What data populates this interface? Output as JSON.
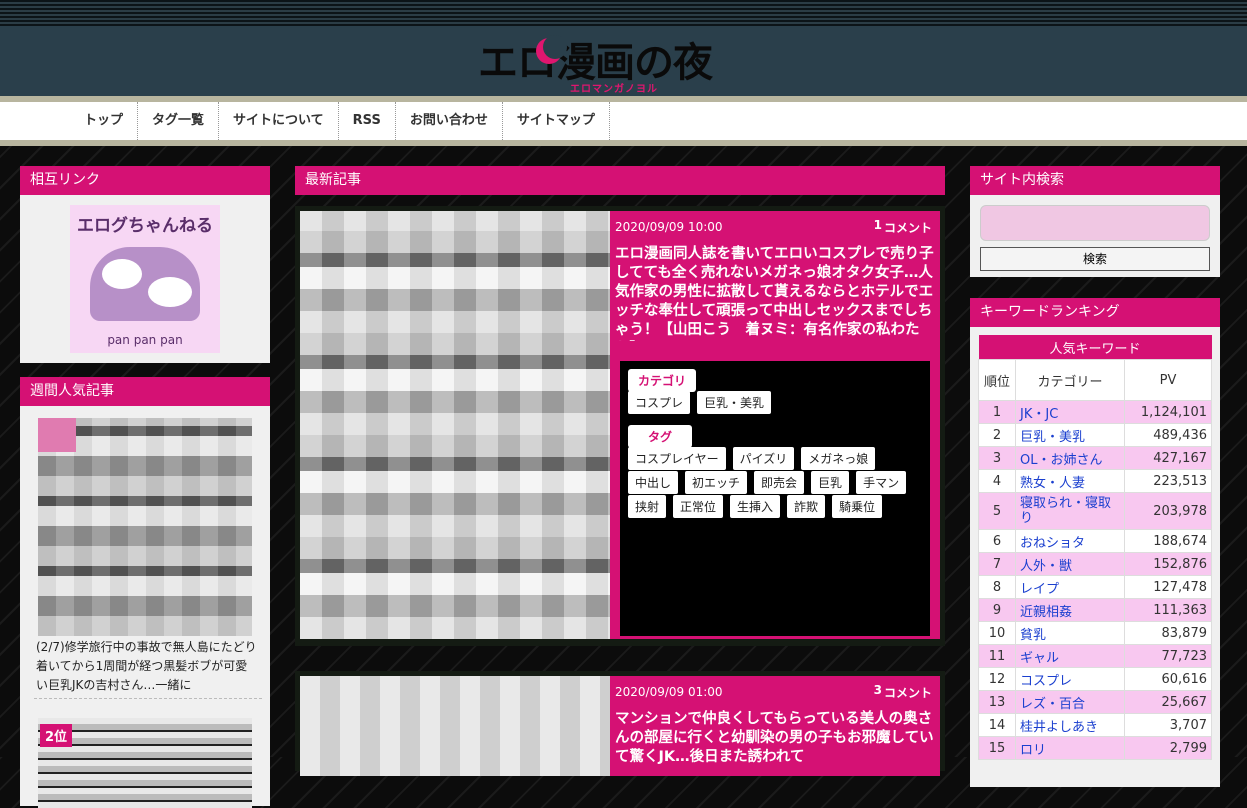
{
  "colors": {
    "accent": "#d51174",
    "header": "#2a3f4b",
    "panel": "#f0f0f0"
  },
  "logo": {
    "title": "エロ漫画の夜",
    "subtitle": "エロマンガノヨル"
  },
  "nav": {
    "items": [
      "トップ",
      "タグ一覧",
      "サイトについて",
      "RSS",
      "お問い合わせ",
      "サイトマップ"
    ]
  },
  "left": {
    "mutual": {
      "title": "相互リンク",
      "banner_title": "エログちゃんねる",
      "banner_sub": "pan pan pan"
    },
    "weekly": {
      "title": "週間人気記事",
      "item1_text": "(2/7)修学旅行中の事故で無人島にたどり着いてから1周間が経つ黒髪ボブが可愛い巨乳JKの吉村さん…一緒に",
      "rank2_badge": "2位"
    }
  },
  "main": {
    "title": "最新記事",
    "articles": [
      {
        "date": "2020/09/09  10:00",
        "comment_count": "1",
        "comment_label": "コメント",
        "title": "エロ漫画同人誌を書いてエロいコスプレで売り子してても全く売れないメガネっ娘オタク女子…人気作家の男性に拡散して貰えるならとホテルでエッチな奉仕して頑張って中出しセックスまでしちゃう！【山田こう　着ヌミ：有名作家の私わたち】",
        "category_label": "カテゴリ",
        "categories": [
          "コスプレ",
          "巨乳・美乳"
        ],
        "tag_label": "タグ",
        "tags_row1": [
          "コスプレイヤー",
          "パイズリ",
          "メガネっ娘"
        ],
        "tags_row2": [
          "中出し",
          "初エッチ",
          "即売会",
          "巨乳",
          "手マン"
        ],
        "tags_row3": [
          "挟射",
          "正常位",
          "生挿入",
          "詐欺",
          "騎乗位"
        ]
      },
      {
        "date": "2020/09/09  01:00",
        "comment_count": "3",
        "comment_label": "コメント",
        "title": "マンションで仲良くしてもらっている美人の奥さんの部屋に行くと幼馴染の男の子もお邪魔していて驚くJK…後日また誘われて"
      }
    ]
  },
  "right": {
    "search": {
      "title": "サイト内検索",
      "button": "検索",
      "placeholder": ""
    },
    "keywords": {
      "title": "キーワードランキング",
      "caption": "人気キーワード",
      "col_rank": "順位",
      "col_category": "カテゴリー",
      "col_pv": "PV",
      "rows": [
        {
          "rank": "1",
          "cat": "JK・JC",
          "pv": "1,124,101"
        },
        {
          "rank": "2",
          "cat": "巨乳・美乳",
          "pv": "489,436"
        },
        {
          "rank": "3",
          "cat": "OL・お姉さん",
          "pv": "427,167"
        },
        {
          "rank": "4",
          "cat": "熟女・人妻",
          "pv": "223,513"
        },
        {
          "rank": "5",
          "cat": "寝取られ・寝取り",
          "pv": "203,978"
        },
        {
          "rank": "6",
          "cat": "おねショタ",
          "pv": "188,674"
        },
        {
          "rank": "7",
          "cat": "人外・獣",
          "pv": "152,876"
        },
        {
          "rank": "8",
          "cat": "レイプ",
          "pv": "127,478"
        },
        {
          "rank": "9",
          "cat": "近親相姦",
          "pv": "111,363"
        },
        {
          "rank": "10",
          "cat": "貧乳",
          "pv": "83,879"
        },
        {
          "rank": "11",
          "cat": "ギャル",
          "pv": "77,723"
        },
        {
          "rank": "12",
          "cat": "コスプレ",
          "pv": "60,616"
        },
        {
          "rank": "13",
          "cat": "レズ・百合",
          "pv": "25,667"
        },
        {
          "rank": "14",
          "cat": "桂井よしあき",
          "pv": "3,707"
        },
        {
          "rank": "15",
          "cat": "ロリ",
          "pv": "2,799"
        }
      ]
    }
  }
}
